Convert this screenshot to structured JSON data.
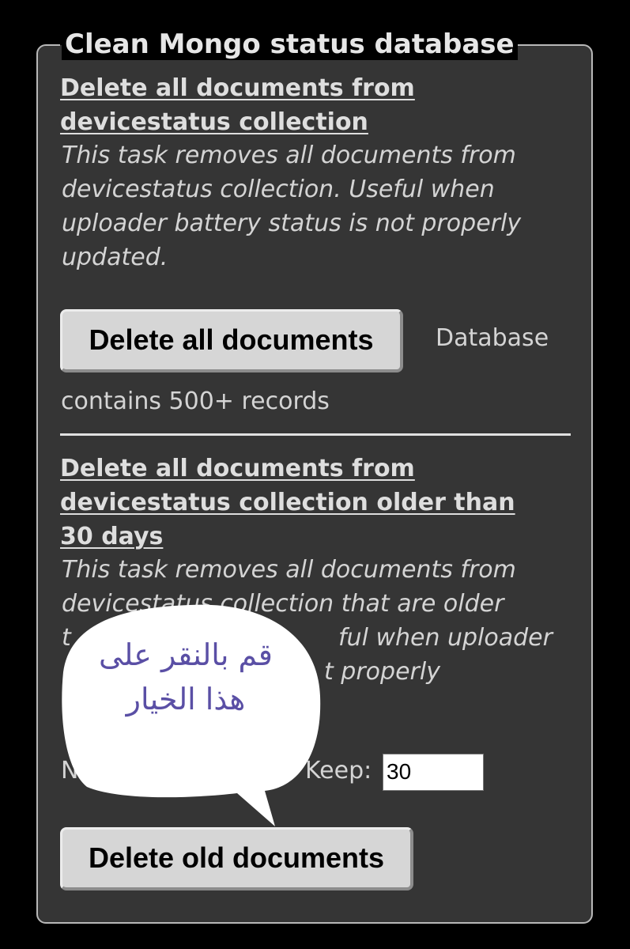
{
  "section": {
    "title": "Clean Mongo status database"
  },
  "task_all": {
    "title": "Delete all documents from devicestatus collection",
    "description": "This task removes all documents from devicestatus collection. Useful when uploader battery status is not properly updated.",
    "button_label": "Delete all documents",
    "status_line1": "Database",
    "status_line2": "contains 500+ records"
  },
  "task_old": {
    "title": "Delete all documents from devicestatus collection older than 30 days",
    "description_l1": "This task removes all documents from",
    "description_l2": "devicestatus collection that are older",
    "description_l3": "t",
    "description_l3b": "ful when uploader",
    "description_l4b": "t properly",
    "partial_left": "N",
    "keep_label": "Keep:",
    "keep_value": "30",
    "button_label": "Delete old documents"
  },
  "annotation": {
    "text": "قم بالنقر على هذا الخيار",
    "color": "#5a4fa5"
  }
}
